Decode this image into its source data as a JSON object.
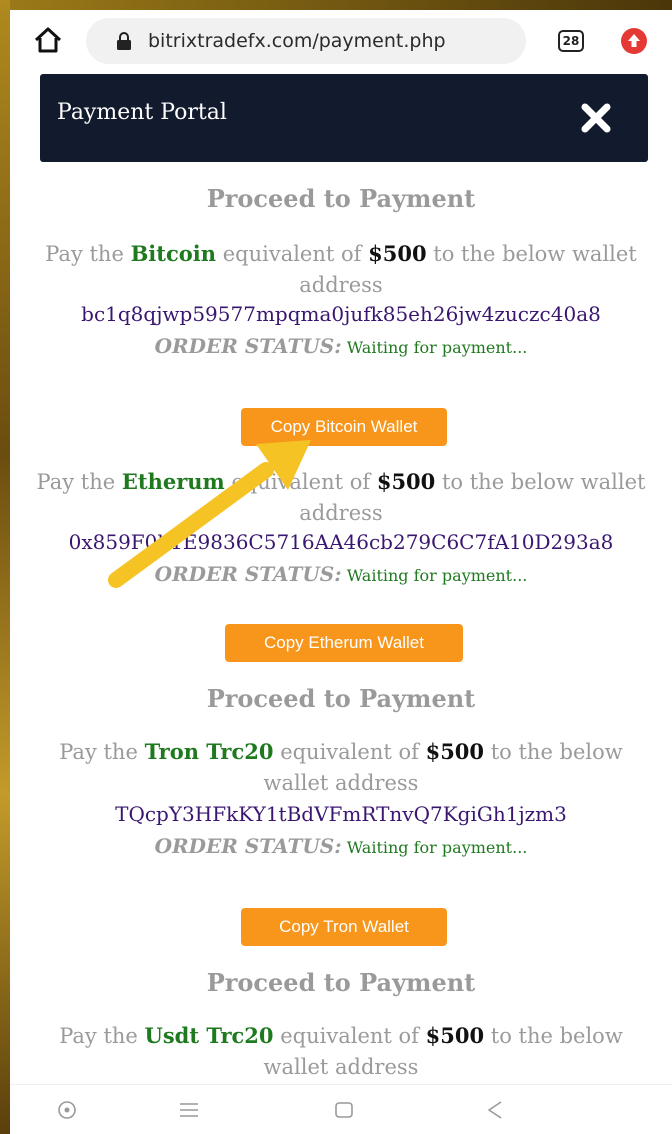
{
  "browser": {
    "url": "bitrixtradefx.com/payment.php",
    "tab_count": "28"
  },
  "portal": {
    "title": "Payment Portal"
  },
  "sections": [
    {
      "heading": "Proceed to Payment",
      "pay_prefix": "Pay the",
      "coin": "Bitcoin",
      "mid": "equivalent of",
      "amount": "$500",
      "suffix": "to the below wallet address",
      "address": "bc1q8qjwp59577mpqma0jufk85eh26jw4zuczc40a8",
      "status_label": "ORDER STATUS:",
      "status_value": "Waiting for payment...",
      "button": "Copy Bitcoin Wallet"
    },
    {
      "pay_prefix": "Pay the",
      "coin": "Etherum",
      "mid": "equivalent of",
      "amount": "$500",
      "suffix": "to the below wallet address",
      "address": "0x859F0b1E9836C5716AA46cb279C6C7fA10D293a8",
      "status_label": "ORDER STATUS:",
      "status_value": "Waiting for payment...",
      "button": "Copy Etherum Wallet"
    },
    {
      "heading": "Proceed to Payment",
      "pay_prefix": "Pay the",
      "coin": "Tron Trc20",
      "mid": "equivalent of",
      "amount": "$500",
      "suffix": "to the below wallet address",
      "address": "TQcpY3HFkKY1tBdVFmRTnvQ7KgiGh1jzm3",
      "status_label": "ORDER STATUS:",
      "status_value": "Waiting for payment...",
      "button": "Copy Tron Wallet"
    },
    {
      "heading": "Proceed to Payment",
      "pay_prefix": "Pay the",
      "coin": "Usdt Trc20",
      "mid": "equivalent of",
      "amount": "$500",
      "suffix": "to the below wallet address"
    }
  ],
  "colors": {
    "header_bg": "#121a2e",
    "button_bg": "#f7961a",
    "coin_green": "#1f7a1f",
    "address_purple": "#3a1670",
    "arrow_yellow": "#f6c324"
  },
  "icons": [
    "home-icon",
    "lock-icon",
    "tabs-icon",
    "upload-icon",
    "close-icon",
    "arrow-icon",
    "nav-home-icon",
    "nav-menu-icon",
    "nav-square-icon",
    "nav-back-icon"
  ]
}
